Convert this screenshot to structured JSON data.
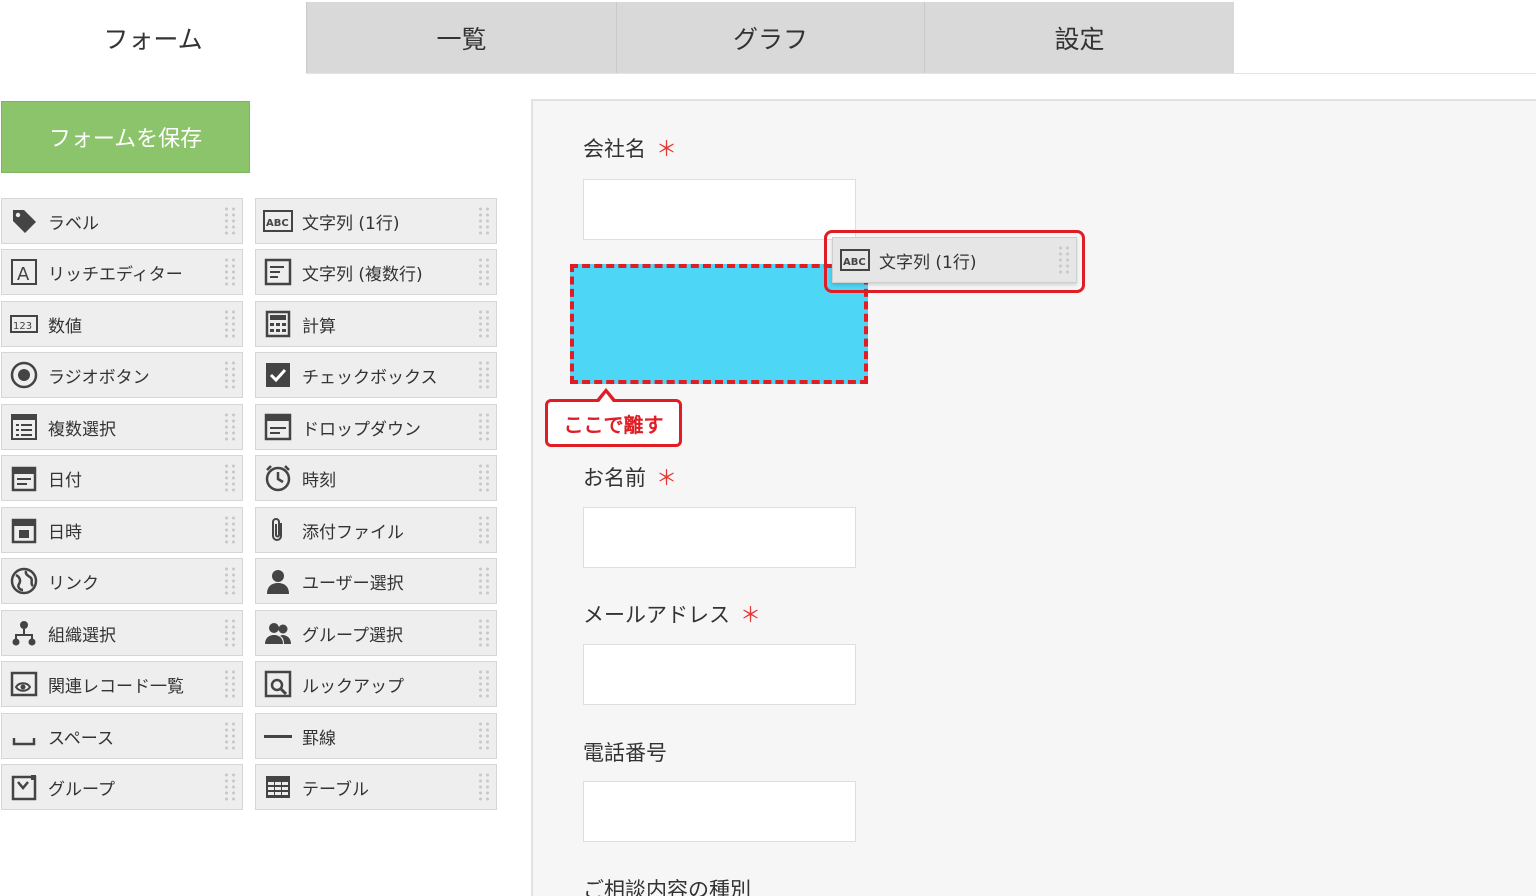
{
  "tabs": [
    {
      "label": "フォーム",
      "active": true
    },
    {
      "label": "一覧",
      "active": false
    },
    {
      "label": "グラフ",
      "active": false
    },
    {
      "label": "設定",
      "active": false
    }
  ],
  "save_button": "フォームを保存",
  "palette": {
    "left": [
      {
        "label": "ラベル",
        "icon": "tag-icon"
      },
      {
        "label": "リッチエディター",
        "icon": "rich-editor-icon"
      },
      {
        "label": "数値",
        "icon": "number-icon"
      },
      {
        "label": "ラジオボタン",
        "icon": "radio-icon"
      },
      {
        "label": "複数選択",
        "icon": "multi-select-icon"
      },
      {
        "label": "日付",
        "icon": "date-icon"
      },
      {
        "label": "日時",
        "icon": "datetime-icon"
      },
      {
        "label": "リンク",
        "icon": "link-globe-icon"
      },
      {
        "label": "組織選択",
        "icon": "org-select-icon"
      },
      {
        "label": "関連レコード一覧",
        "icon": "related-records-icon"
      },
      {
        "label": "スペース",
        "icon": "space-icon"
      },
      {
        "label": "グループ",
        "icon": "group-field-icon"
      }
    ],
    "right": [
      {
        "label": "文字列 (1行)",
        "icon": "text-single-line-icon"
      },
      {
        "label": "文字列 (複数行)",
        "icon": "text-multi-line-icon"
      },
      {
        "label": "計算",
        "icon": "calculator-icon"
      },
      {
        "label": "チェックボックス",
        "icon": "checkbox-icon"
      },
      {
        "label": "ドロップダウン",
        "icon": "dropdown-icon"
      },
      {
        "label": "時刻",
        "icon": "clock-icon"
      },
      {
        "label": "添付ファイル",
        "icon": "paperclip-icon"
      },
      {
        "label": "ユーザー選択",
        "icon": "user-icon"
      },
      {
        "label": "グループ選択",
        "icon": "users-group-icon"
      },
      {
        "label": "ルックアップ",
        "icon": "lookup-icon"
      },
      {
        "label": "罫線",
        "icon": "line-icon"
      },
      {
        "label": "テーブル",
        "icon": "table-icon"
      }
    ]
  },
  "form": {
    "fields": [
      {
        "label": "会社名",
        "required": "＊"
      },
      {
        "label": "お名前",
        "required": "＊"
      },
      {
        "label": "メールアドレス",
        "required": "＊"
      },
      {
        "label": "電話番号",
        "required": ""
      },
      {
        "label": "ご相談内容の種別",
        "required": ""
      }
    ]
  },
  "drop_callout": "ここで離す",
  "dragging_item": {
    "label": "文字列 (1行)",
    "icon": "text-single-line-icon"
  },
  "colors": {
    "accent_green": "#8bc46a",
    "drop_zone": "#4dd6f5",
    "highlight_red": "#e01d24",
    "required_red": "#e53935"
  }
}
